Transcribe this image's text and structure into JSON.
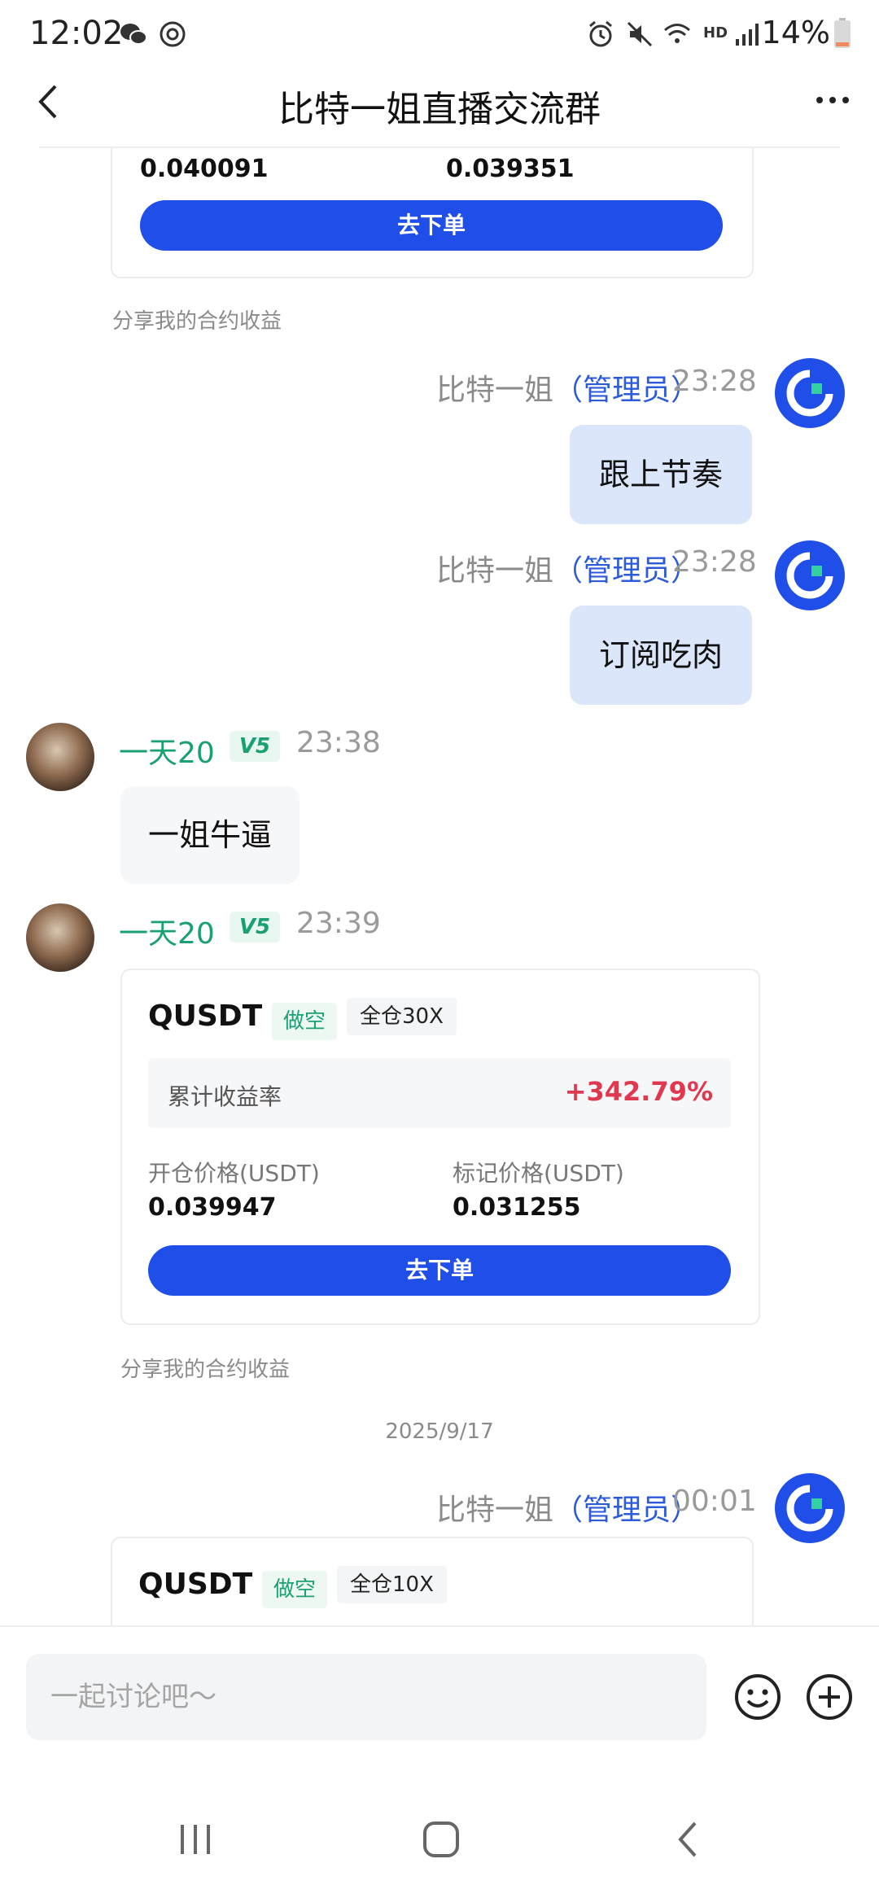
{
  "status_bar": {
    "time": "12:02",
    "hd_label": "HD",
    "battery": "14%"
  },
  "header": {
    "title": "比特一姐直播交流群"
  },
  "messages": {
    "top_card": {
      "open_price": "0.040091",
      "mark_price": "0.039351",
      "button": "去下单",
      "share_note": "分享我的合约收益"
    },
    "admin_msg_1": {
      "sender": "比特一姐",
      "role": "（管理员）",
      "time": "23:28",
      "text": "跟上节奏"
    },
    "admin_msg_2": {
      "sender": "比特一姐",
      "role": "（管理员）",
      "time": "23:28",
      "text": "订阅吃肉"
    },
    "user_msg_1": {
      "sender": "一天20",
      "vip": "V5",
      "time": "23:38",
      "text": "一姐牛逼"
    },
    "user_msg_2": {
      "sender": "一天20",
      "vip": "V5",
      "time": "23:39",
      "card": {
        "symbol": "QUSDT",
        "direction": "做空",
        "leverage": "全仓30X",
        "return_label": "累计收益率",
        "return_value": "+342.79%",
        "open_label": "开仓价格(USDT)",
        "open_price": "0.039947",
        "mark_label": "标记价格(USDT)",
        "mark_price": "0.031255",
        "button": "去下单"
      },
      "share_note": "分享我的合约收益"
    },
    "date_separator": "2025/9/17",
    "admin_msg_3": {
      "sender": "比特一姐",
      "role": "（管理员）",
      "time": "00:01",
      "card": {
        "symbol": "QUSDT",
        "direction": "做空",
        "leverage": "全仓10X"
      }
    }
  },
  "input": {
    "placeholder": "一起讨论吧～"
  },
  "colors": {
    "accent_blue": "#1f4ee8",
    "admin_role": "#2d5bd8",
    "user_green": "#1aa073",
    "profit_red": "#e0394f",
    "my_bubble": "#dbe6fb"
  },
  "icons": [
    "wechat-icon",
    "app-notification-icon",
    "alarm-icon",
    "mute-icon",
    "wifi-icon",
    "signal-icon",
    "battery-icon",
    "back-arrow-icon",
    "more-icon",
    "admin-avatar-icon",
    "emoji-icon",
    "plus-icon",
    "recent-apps-icon",
    "home-icon",
    "nav-back-icon"
  ]
}
